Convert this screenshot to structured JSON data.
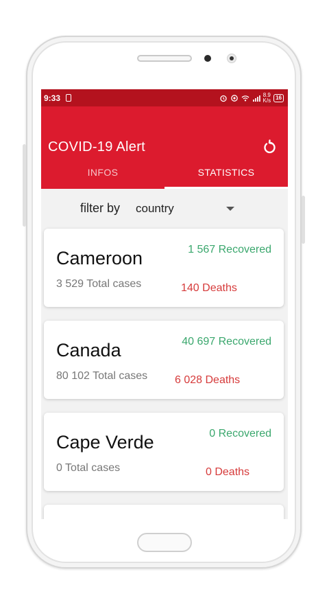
{
  "statusbar": {
    "time": "9:33",
    "net_speed_top": "8.9",
    "net_speed_bottom": "K/s",
    "battery": "16"
  },
  "app": {
    "title": "COVID-19 Alert",
    "refresh_icon": "refresh-icon"
  },
  "tabs": [
    {
      "label": "INFOS",
      "selected": false
    },
    {
      "label": "STATISTICS",
      "selected": true
    }
  ],
  "filter": {
    "label": "filter by",
    "value": "country"
  },
  "countries": [
    {
      "name": "Cameroon",
      "total": "3 529 Total cases",
      "recovered": "1 567 Recovered",
      "deaths": "140 Deaths"
    },
    {
      "name": "Canada",
      "total": "80 102 Total cases",
      "recovered": "40 697 Recovered",
      "deaths": "6 028 Deaths"
    },
    {
      "name": "Cape Verde",
      "total": "0 Total cases",
      "recovered": "0 Recovered",
      "deaths": "0 Deaths"
    }
  ],
  "colors": {
    "appbar": "#dc1b2e",
    "statusbar": "#b4121e",
    "recovered": "#3aa76d",
    "deaths": "#d63a3a"
  }
}
